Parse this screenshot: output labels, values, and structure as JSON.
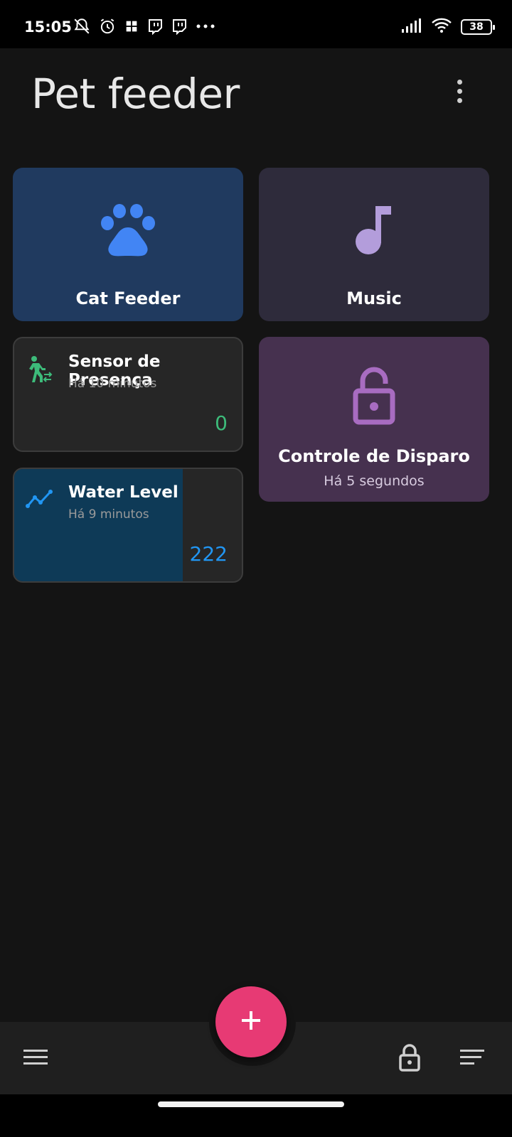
{
  "status_bar": {
    "time": "15:05",
    "left_icons": [
      "muted-bell-icon",
      "alarm-icon",
      "app-grid-icon",
      "twitch-icon",
      "twitch-icon",
      "more-dots-icon"
    ],
    "right_icons": [
      "signal-icon",
      "wifi-icon",
      "battery-icon"
    ],
    "battery": "38"
  },
  "header": {
    "title": "Pet feeder",
    "menu_icon": "more-vert-icon"
  },
  "tiles": {
    "cat_feeder": {
      "label": "Cat Feeder",
      "icon": "paw-icon",
      "color": "#203a5f",
      "icon_color": "#4285f4"
    },
    "music": {
      "label": "Music",
      "icon": "music-note-icon",
      "color": "#2e2b3b",
      "icon_color": "#b39ddb"
    },
    "sensor": {
      "title": "Sensor de Presença",
      "subtitle": "Há 10 minutos",
      "value": "0",
      "icon": "walking-person-icon",
      "value_color": "#3dbb7a"
    },
    "disparo": {
      "label": "Controle de Disparo",
      "subtitle": "Há 5 segundos",
      "icon": "lock-open-icon",
      "color": "#46314f",
      "icon_color": "#a86cc1"
    },
    "water": {
      "title": "Water Level",
      "subtitle": "Há 9 minutos",
      "value": "222",
      "icon": "trend-line-icon",
      "value_color": "#2196f3",
      "fill_fraction": 0.74
    }
  },
  "bottom_bar": {
    "fab_icon": "plus-icon",
    "fab_color": "#e73a74",
    "left_icon": "hamburger-menu-icon",
    "right_icons": [
      "lock-icon",
      "sort-lines-icon"
    ]
  }
}
